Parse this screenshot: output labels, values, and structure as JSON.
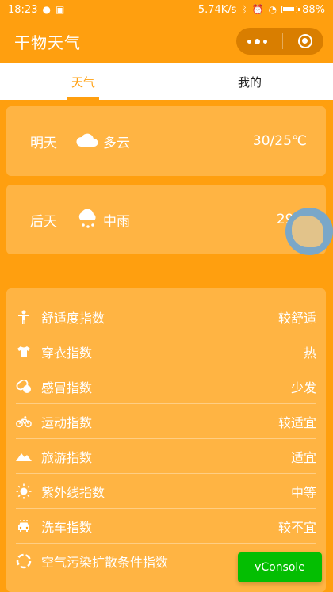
{
  "status": {
    "time": "18:23",
    "speed": "5.74K/s",
    "battery": "88%"
  },
  "nav": {
    "title": "干物天气"
  },
  "tabs": [
    {
      "label": "天气"
    },
    {
      "label": "我的"
    }
  ],
  "forecast": [
    {
      "day": "明天",
      "icon": "cloud-icon",
      "condition": "多云",
      "temp": "30/25℃"
    },
    {
      "day": "后天",
      "icon": "rain-icon",
      "condition": "中雨",
      "temp": "29/2"
    }
  ],
  "indices": [
    {
      "name": "舒适度指数",
      "value": "较舒适",
      "icon": "person-icon"
    },
    {
      "name": "穿衣指数",
      "value": "热",
      "icon": "shirt-icon"
    },
    {
      "name": "感冒指数",
      "value": "少发",
      "icon": "pill-icon"
    },
    {
      "name": "运动指数",
      "value": "较适宜",
      "icon": "bicycle-icon"
    },
    {
      "name": "旅游指数",
      "value": "适宜",
      "icon": "mountain-icon"
    },
    {
      "name": "紫外线指数",
      "value": "中等",
      "icon": "sun-icon"
    },
    {
      "name": "洗车指数",
      "value": "较不宜",
      "icon": "car-icon"
    },
    {
      "name": "空气污染扩散条件指数",
      "value": "",
      "icon": "air-icon"
    }
  ],
  "vconsole": {
    "label": "vConsole"
  },
  "colors": {
    "background": "#ff9f0f",
    "vconsole": "#04be02"
  }
}
